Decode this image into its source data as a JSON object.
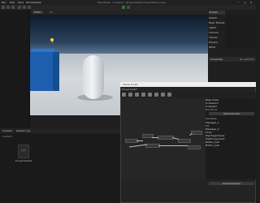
{
  "titlebar": {
    "path": "Play Mode - C:\\Users\\...\\Projects\\New Project\\Main.scene"
  },
  "menu": [
    "File",
    "Edit",
    "Tools",
    "Window",
    "Help"
  ],
  "viewport": {
    "tab": "Editor",
    "shading": "Lit"
  },
  "right_panel": {
    "tabs": [
      "Toolbar",
      "Search",
      "Basic Models",
      "Lights",
      "Camera",
      "Visuals",
      "Physics",
      "Other"
    ],
    "properties_title": "Properties",
    "status": "No selected"
  },
  "bottom": {
    "tabs": [
      "Console",
      "Output Log"
    ],
    "breadcrumb": "Content",
    "asset_name": "PropertiesSet"
  },
  "blueprint": {
    "title": "Visual Script",
    "subtitle": "PropertySet*",
    "details_rows": [
      "Base Class",
      "Is Abstract",
      "Is Sealed",
      "Functions",
      "Add Override",
      "Variables",
      "Message_1",
      "Int",
      "Message_2",
      "Float",
      "MyIntegerValue",
      "MyStrArgument",
      "Button_ball",
      "Button_ball"
    ],
    "footer_button": "Add parameter"
  }
}
